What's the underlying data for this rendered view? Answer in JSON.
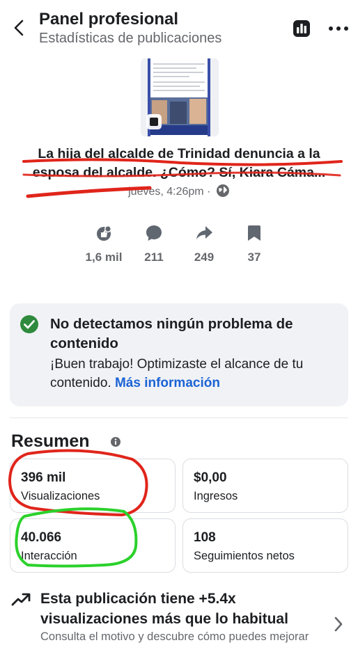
{
  "header": {
    "title": "Panel profesional",
    "subtitle": "Estadísticas de publicaciones",
    "icons": [
      "back-chevron-icon",
      "bar-chart-icon",
      "more-dots-icon"
    ]
  },
  "post": {
    "text_line1": "La hija del alcalde de Trinidad denuncia a la",
    "text_line2": "esposa del alcalde. ¿Cómo? Sí, Kiara Cáma...",
    "meta": "jueves, 4:26pm ·",
    "meta_icon": "globe-icon"
  },
  "metrics": [
    {
      "icon": "reactions-icon",
      "value": "1,6 mil"
    },
    {
      "icon": "comment-icon",
      "value": "211"
    },
    {
      "icon": "share-icon",
      "value": "249"
    },
    {
      "icon": "bookmark-icon",
      "value": "37"
    }
  ],
  "banner": {
    "icon": "check-circle-icon",
    "title": "No detectamos ningún problema de contenido",
    "text": "¡Buen trabajo! Optimizaste el alcance de tu contenido.",
    "link": "Más información",
    "accent": "#1b63d6",
    "check_color": "#2f8a3e"
  },
  "summary": {
    "title": "Resumen",
    "cards": [
      {
        "value": "396 mil",
        "label": "Visualizaciones"
      },
      {
        "value": "$0,00",
        "label": "Ingresos"
      },
      {
        "value": "40.066",
        "label": "Interacción"
      },
      {
        "value": "108",
        "label": "Seguimientos netos"
      }
    ]
  },
  "insight": {
    "icon": "trending-up-icon",
    "title": "Esta publicación tiene +5.4x visualizaciones más que lo habitual",
    "subtitle": "Consulta el motivo y descubre cómo puedes mejorar"
  },
  "annotation_colors": {
    "red": "#e0251b",
    "green": "#2bd12b"
  }
}
